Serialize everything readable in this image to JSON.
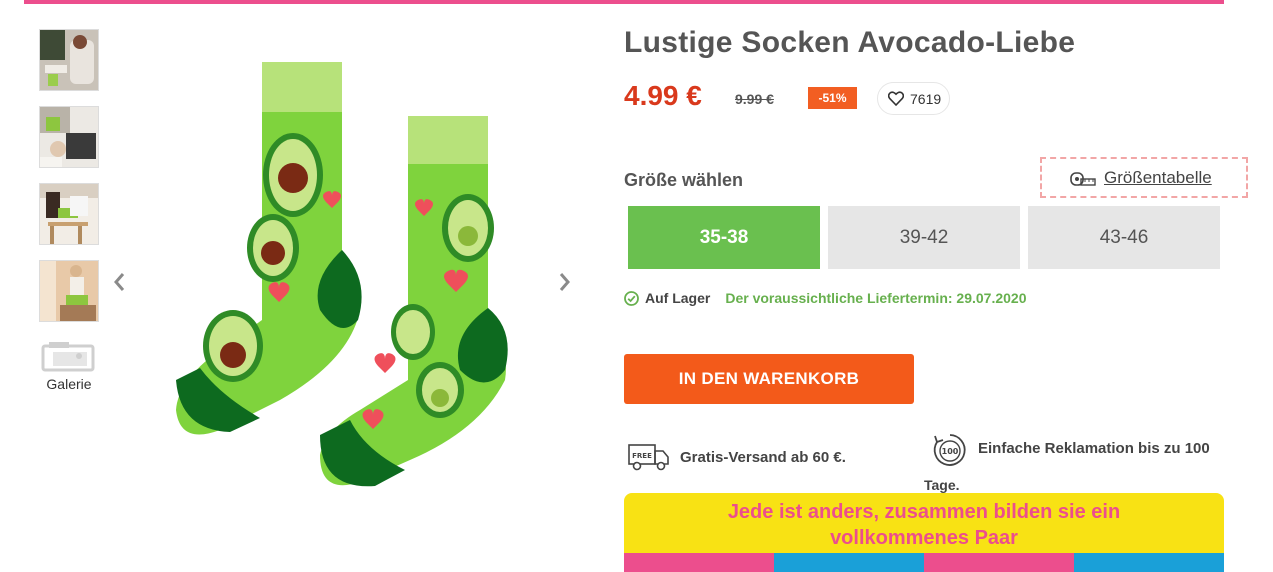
{
  "product": {
    "title": "Lustige Socken Avocado-Liebe",
    "price": "4.99 €",
    "old_price": "9.99 €",
    "discount": "-51%",
    "wishlist_count": "7619"
  },
  "gallery": {
    "label": "Galerie",
    "thumbnail_count": 4
  },
  "sizes": {
    "label": "Größe wählen",
    "table_link": "Größentabelle",
    "options": [
      "35-38",
      "39-42",
      "43-46"
    ],
    "selected": "35-38"
  },
  "stock": {
    "status": "Auf Lager",
    "delivery": "Der voraussichtliche Liefertermin: 29.07.2020"
  },
  "cart": {
    "label": "IN DEN WARENKORB"
  },
  "features": {
    "shipping": "Gratis-Versand ab 60 €.",
    "shipping_icon_text": "FREE",
    "returns_line1": "Einfache Reklamation bis zu 100",
    "returns_line2": "Tage.",
    "returns_icon_text": "100"
  },
  "banner": {
    "line1": "Jede ist anders, zusammen bilden sie ein",
    "line2": "vollkommenes Paar"
  },
  "colors": {
    "accent_pink": "#ec4e8d",
    "price_red": "#d9391c",
    "cart_orange": "#f35a1a",
    "size_active_green": "#6ac04f",
    "delivery_green": "#67b04e",
    "banner_yellow": "#f8e214"
  }
}
